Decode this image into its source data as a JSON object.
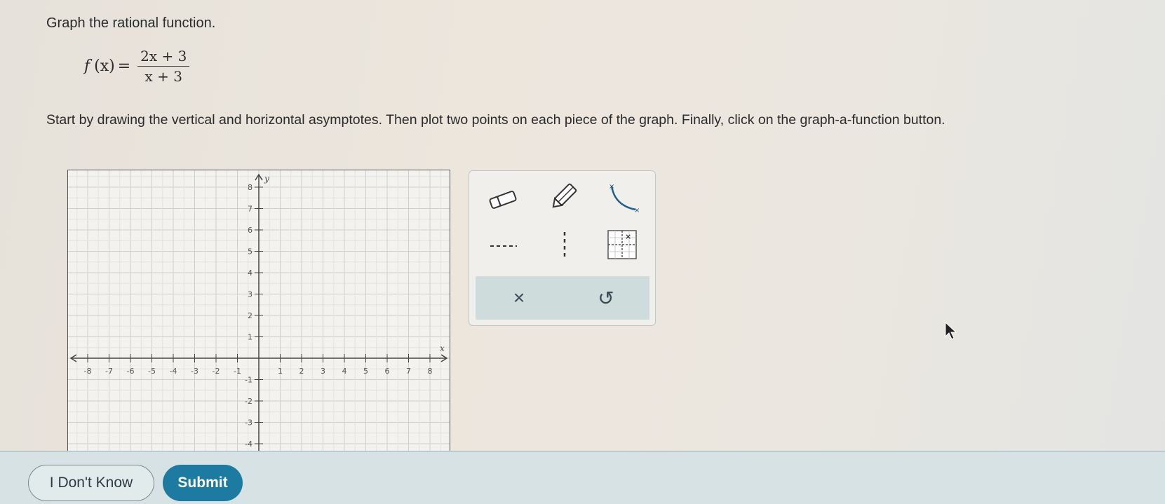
{
  "question": {
    "prompt": "Graph the rational function.",
    "function_lhs": "f",
    "function_arg": "(x)",
    "equals": "=",
    "numerator": "2x + 3",
    "denominator": "x + 3",
    "instructions": "Start by drawing the vertical and horizontal asymptotes. Then plot two points on each piece of the graph. Finally, click on the graph-a-function button."
  },
  "graph": {
    "x_axis_label": "x",
    "y_axis_label": "y",
    "x_ticks": [
      "-8",
      "-7",
      "-6",
      "-5",
      "-4",
      "-3",
      "-2",
      "-1",
      "1",
      "2",
      "3",
      "4",
      "5",
      "6",
      "7",
      "8"
    ],
    "y_ticks": [
      "8",
      "7",
      "6",
      "5",
      "4",
      "3",
      "2",
      "1",
      "-1",
      "-2",
      "-3",
      "-4"
    ]
  },
  "tools": {
    "eraser": "eraser-icon",
    "pencil": "pencil-icon",
    "graph_function": "curve-icon",
    "horizontal_asymptote": "horizontal-dashed-line-icon",
    "vertical_asymptote": "vertical-dashed-line-icon",
    "asymptote_grid": "grid-point-icon",
    "clear_symbol": "×",
    "undo_symbol": "↺"
  },
  "footer": {
    "dont_know_label": "I Don't Know",
    "submit_label": "Submit"
  },
  "colors": {
    "submit_bg": "#1d7aa0",
    "tool_bar_bg": "#cfdcdc",
    "footer_bg": "#d6e2e4"
  }
}
